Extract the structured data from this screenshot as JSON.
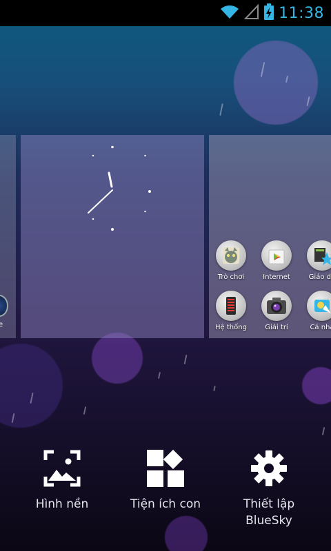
{
  "status_bar": {
    "time": "11:38"
  },
  "clock_widget": {
    "style": "analog"
  },
  "panel_right": {
    "apps": [
      {
        "label": "Trò chơi",
        "icon": "game-folder-icon"
      },
      {
        "label": "Internet",
        "icon": "play-store-icon"
      },
      {
        "label": "Giáo dụ",
        "icon": "education-folder-icon"
      },
      {
        "label": "Hệ thống",
        "icon": "system-folder-icon"
      },
      {
        "label": "Giải trí",
        "icon": "camera-folder-icon"
      },
      {
        "label": "Cá nhâ",
        "icon": "personal-folder-icon"
      }
    ]
  },
  "panel_left": {
    "label": "e"
  },
  "bottom_menu": {
    "wallpaper_label": "Hình nền",
    "widgets_label": "Tiện ích con",
    "settings_label_line1": "Thiết lập",
    "settings_label_line2": "BlueSky"
  },
  "colors": {
    "accent": "#35b5e5",
    "status_bar": "#000000"
  }
}
